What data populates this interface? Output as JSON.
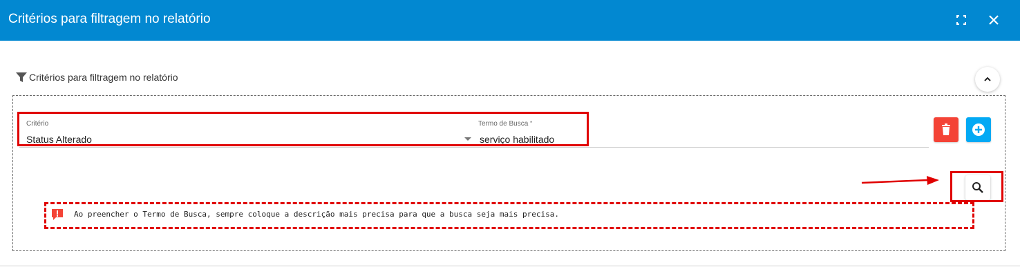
{
  "dialog": {
    "title": "Critérios para filtragem no relatório",
    "maximize_icon": "fullscreen-icon",
    "close_icon": "close-icon"
  },
  "section": {
    "title": "Critérios para filtragem no relatório",
    "icon": "filter-icon",
    "collapse_icon": "chevron-up-icon"
  },
  "criteria": {
    "criterio_label": "Critério",
    "criterio_value": "Status Alterado",
    "termo_label": "Termo de Busca",
    "termo_required_mark": "*",
    "termo_value": "serviço habilitado"
  },
  "actions": {
    "delete_icon": "trash-icon",
    "add_icon": "plus-circle-icon",
    "search_icon": "search-icon"
  },
  "note": {
    "icon": "alert-message-icon",
    "text": "Ao preencher o Termo de Busca, sempre coloque a descrição mais precisa para que a busca seja mais precisa."
  },
  "colors": {
    "header": "#0288d1",
    "delete": "#f44336",
    "add": "#03a9f4",
    "annotation": "#e00000"
  }
}
